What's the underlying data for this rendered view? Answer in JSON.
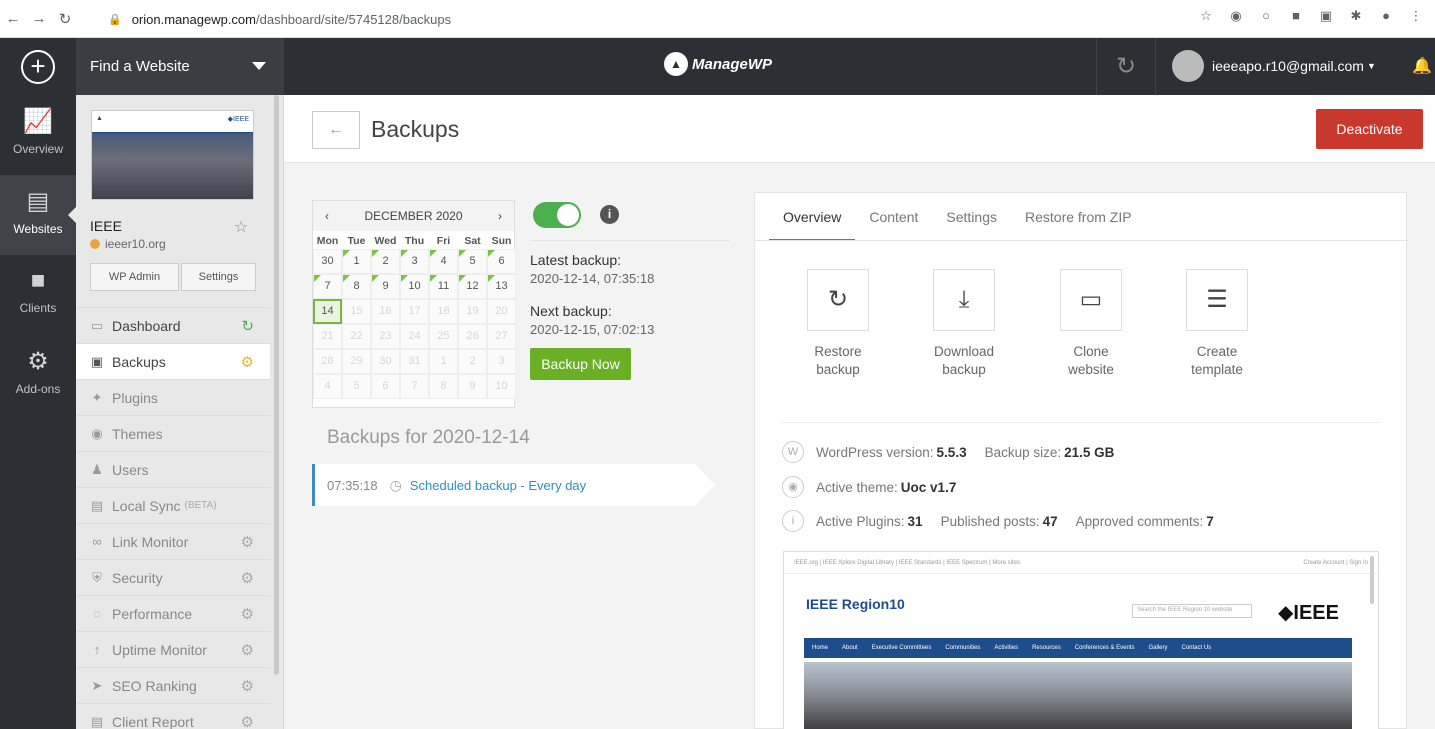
{
  "browser": {
    "url_host": "orion.managewp.com",
    "url_path": "/dashboard/site/5745128/backups"
  },
  "topbar": {
    "find_label": "Find a Website",
    "brand": "ManageWP",
    "user_email": "ieeeapo.r10@gmail.com"
  },
  "rail": [
    {
      "label": "Overview",
      "icon": "chart-icon"
    },
    {
      "label": "Websites",
      "icon": "websites-icon"
    },
    {
      "label": "Clients",
      "icon": "clients-icon"
    },
    {
      "label": "Add-ons",
      "icon": "addons-icon"
    }
  ],
  "site": {
    "name": "IEEE",
    "url": "ieeer10.org",
    "wp_admin": "WP Admin",
    "settings": "Settings"
  },
  "menu": [
    {
      "label": "Dashboard"
    },
    {
      "label": "Backups"
    },
    {
      "label": "Plugins"
    },
    {
      "label": "Themes"
    },
    {
      "label": "Users"
    },
    {
      "label": "Local Sync",
      "badge": "(BETA)"
    },
    {
      "label": "Link Monitor"
    },
    {
      "label": "Security"
    },
    {
      "label": "Performance"
    },
    {
      "label": "Uptime Monitor"
    },
    {
      "label": "SEO Ranking"
    },
    {
      "label": "Client Report"
    }
  ],
  "page": {
    "title": "Backups",
    "deactivate": "Deactivate"
  },
  "calendar": {
    "month": "DECEMBER 2020",
    "dows": [
      "Mon",
      "Tue",
      "Wed",
      "Thu",
      "Fri",
      "Sat",
      "Sun"
    ],
    "days": [
      "30",
      "1",
      "2",
      "3",
      "4",
      "5",
      "6",
      "7",
      "8",
      "9",
      "10",
      "11",
      "12",
      "13",
      "14",
      "15",
      "16",
      "17",
      "18",
      "19",
      "20",
      "21",
      "22",
      "23",
      "24",
      "25",
      "26",
      "27",
      "28",
      "29",
      "30",
      "31",
      "1",
      "2",
      "3",
      "4",
      "5",
      "6",
      "7",
      "8",
      "9",
      "10"
    ],
    "selected": "14"
  },
  "backup_info": {
    "latest_label": "Latest backup:",
    "latest_value": "2020-12-14, 07:35:18",
    "next_label": "Next backup:",
    "next_value": "2020-12-15, 07:02:13",
    "backup_now": "Backup Now"
  },
  "backups_list": {
    "heading": "Backups for 2020-12-14",
    "rows": [
      {
        "time": "07:35:18",
        "type": "Scheduled backup - Every day"
      }
    ]
  },
  "card": {
    "tabs": [
      "Overview",
      "Content",
      "Settings",
      "Restore from ZIP"
    ],
    "actions": [
      {
        "line1": "Restore",
        "line2": "backup",
        "icon": "restore-icon"
      },
      {
        "line1": "Download",
        "line2": "backup",
        "icon": "download-icon"
      },
      {
        "line1": "Clone",
        "line2": "website",
        "icon": "monitor-icon"
      },
      {
        "line1": "Create",
        "line2": "template",
        "icon": "template-icon"
      }
    ],
    "wp_version_label": "WordPress version:",
    "wp_version": "5.5.3",
    "backup_size_label": "Backup size:",
    "backup_size": "21.5 GB",
    "theme_label": "Active theme:",
    "theme": "Uoc v1.7",
    "plugins_label": "Active Plugins:",
    "plugins": "31",
    "posts_label": "Published posts:",
    "posts": "47",
    "comments_label": "Approved comments:",
    "comments": "7"
  },
  "preview": {
    "top_links": "IEEE.org  |  IEEE Xplore Digital Library  |  IEEE Standards  |  IEEE Spectrum  |  More sites",
    "top_right": "Create Account  |  Sign In",
    "logo": "IEEE Region10",
    "search_placeholder": "Search the IEEE Region 10 website",
    "brand": "IEEE",
    "nav": [
      "Home",
      "About",
      "Executive Committees",
      "Communities",
      "Activities",
      "Resources",
      "Conferences & Events",
      "Gallery",
      "Contact Us"
    ]
  },
  "colors": {
    "accent_blue": "#2a8fbd",
    "danger_red": "#c8382d",
    "success_green": "#6bb024",
    "dark_bar": "#2c2f33"
  }
}
